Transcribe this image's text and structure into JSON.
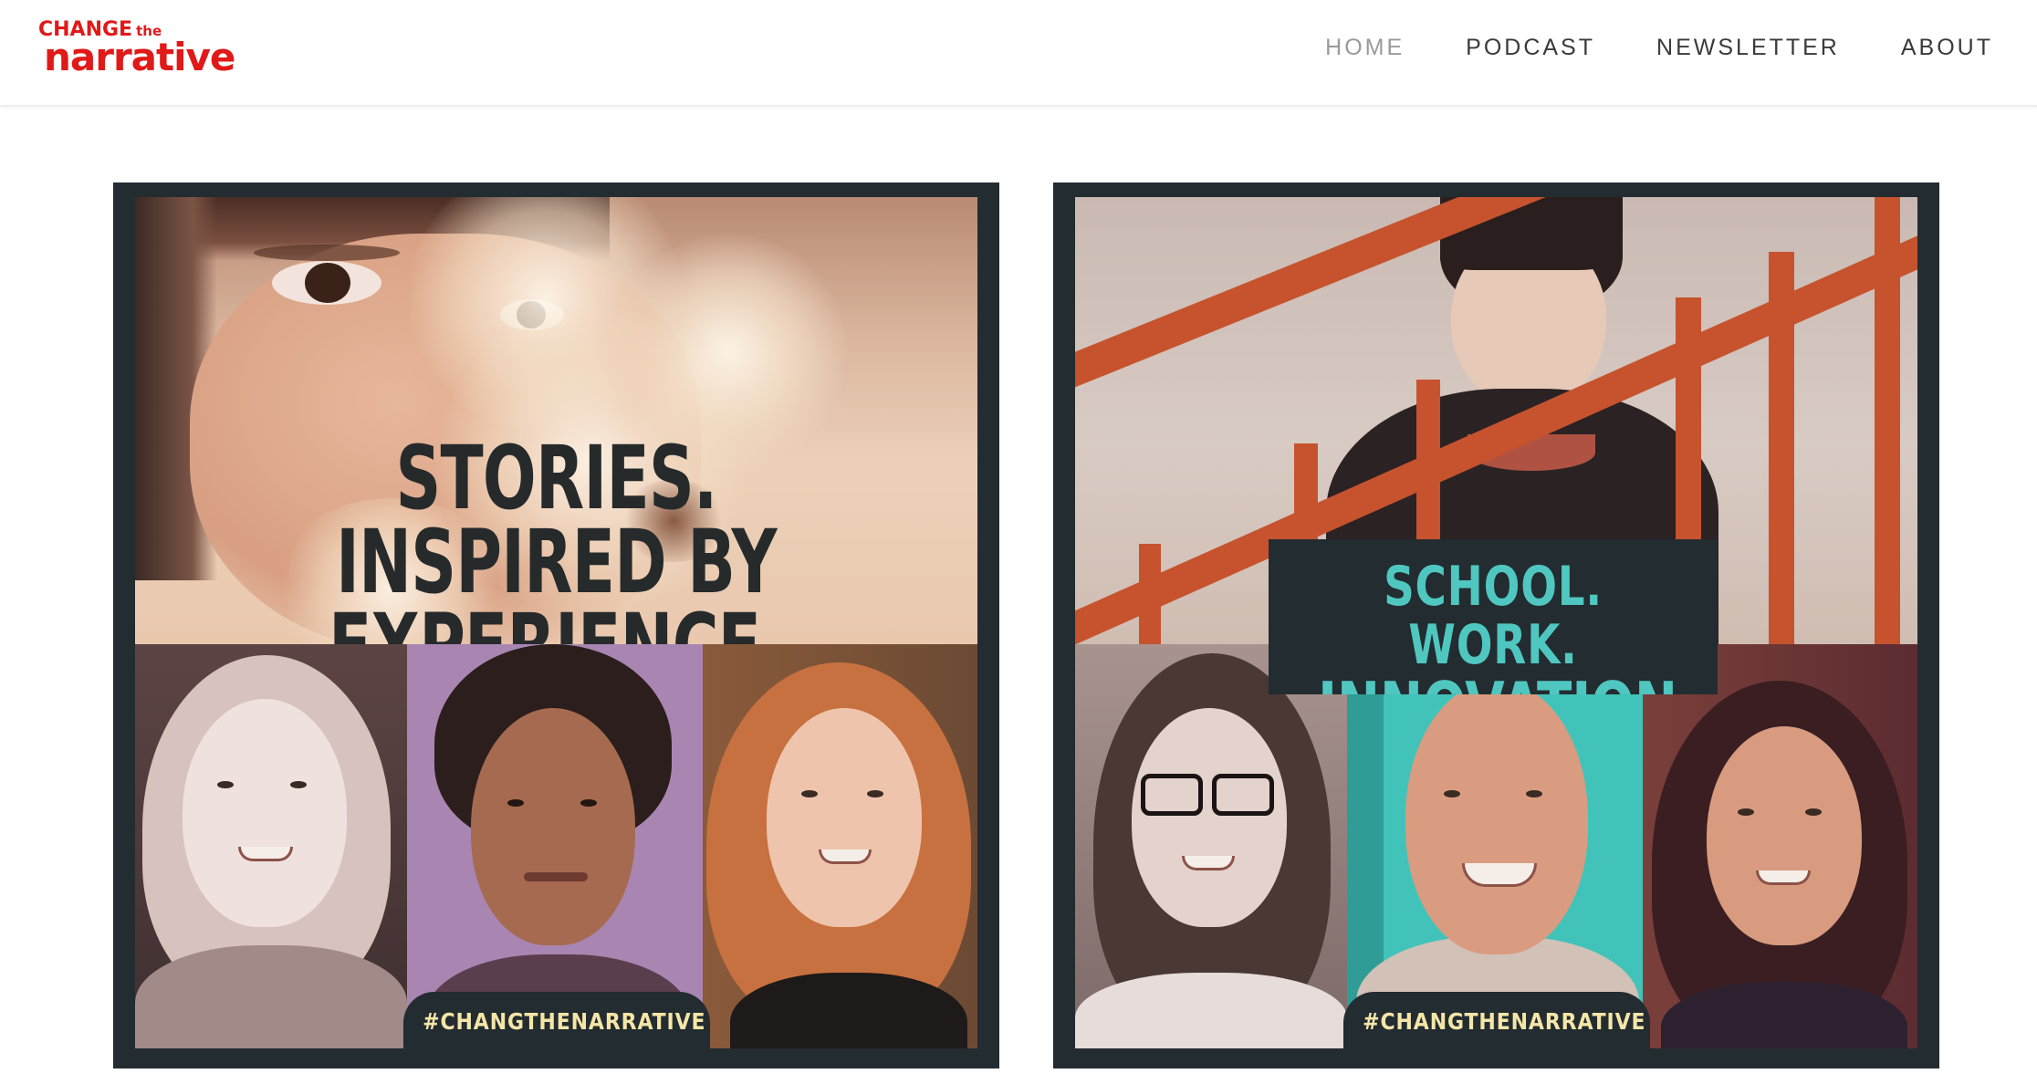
{
  "header": {
    "logo": {
      "line1": "CHANGE",
      "line1_small": "the",
      "line2": "narrative"
    },
    "nav": [
      {
        "label": "HOME",
        "active": true
      },
      {
        "label": "PODCAST",
        "active": false
      },
      {
        "label": "NEWSLETTER",
        "active": false
      },
      {
        "label": "ABOUT",
        "active": false
      }
    ]
  },
  "cards": [
    {
      "headline_line1": "STORIES. INSPIRED BY",
      "headline_line2": "EXPERIENCE.",
      "hashtag": "#CHANGTHENARRATIVE"
    },
    {
      "headline_line1": "SCHOOL. WORK.",
      "headline_line2": "INNOVATION.",
      "hashtag": "#CHANGTHENARRATIVE"
    }
  ],
  "colors": {
    "brand_red": "#e01919",
    "card_frame": "#232c30",
    "teal_text": "#4fc7c0",
    "hashtag_text": "#f5e6a8",
    "nav_text": "#3a3a3a",
    "nav_active": "#9a9a9a"
  }
}
